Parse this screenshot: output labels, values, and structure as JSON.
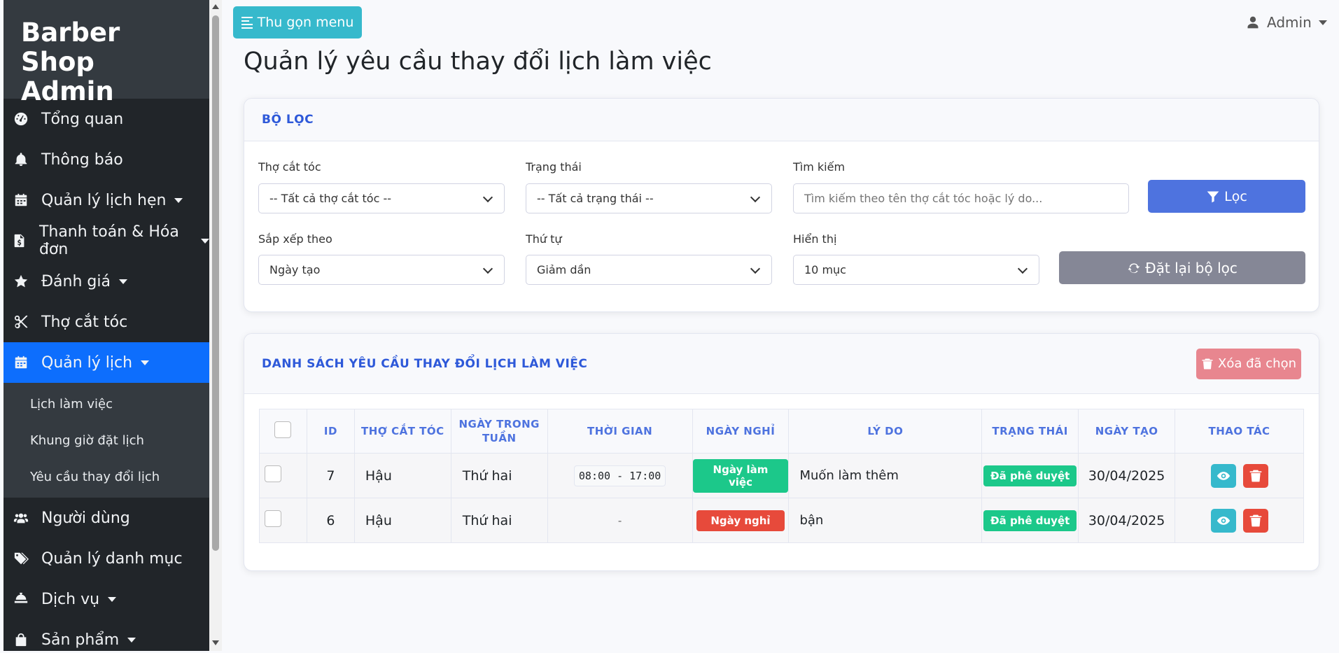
{
  "sidebar": {
    "brand": "Barber Shop Admin",
    "items": [
      {
        "label": "Tổng quan",
        "icon": "dashboard-icon"
      },
      {
        "label": "Thông báo",
        "icon": "bell-icon"
      },
      {
        "label": "Quản lý lịch hẹn",
        "icon": "calendar-icon",
        "dropdown": true
      },
      {
        "label": "Thanh toán & Hóa đơn",
        "icon": "invoice-icon",
        "dropdown": true
      },
      {
        "label": "Đánh giá",
        "icon": "star-icon",
        "dropdown": true
      },
      {
        "label": "Thợ cắt tóc",
        "icon": "scissors-icon"
      },
      {
        "label": "Quản lý lịch",
        "icon": "calendar-icon",
        "dropdown": true,
        "active": true
      },
      {
        "label": "Người dùng",
        "icon": "users-icon"
      },
      {
        "label": "Quản lý danh mục",
        "icon": "tags-icon"
      },
      {
        "label": "Dịch vụ",
        "icon": "service-bell-icon",
        "dropdown": true
      },
      {
        "label": "Sản phẩm",
        "icon": "shopping-bag-icon",
        "dropdown": true
      }
    ],
    "subitems": [
      "Lịch làm việc",
      "Khung giờ đặt lịch",
      "Yêu cầu thay đổi lịch"
    ]
  },
  "topbar": {
    "toggle_label": "Thu gọn menu",
    "user_label": "Admin"
  },
  "page_title": "Quản lý yêu cầu thay đổi lịch làm việc",
  "filter": {
    "title": "BỘ LỌC",
    "barber_label": "Thợ cắt tóc",
    "barber_value": "-- Tất cả thợ cắt tóc --",
    "status_label": "Trạng thái",
    "status_value": "-- Tất cả trạng thái --",
    "search_label": "Tìm kiếm",
    "search_placeholder": "Tìm kiếm theo tên thợ cắt tóc hoặc lý do...",
    "filter_button": "Lọc",
    "sort_label": "Sắp xếp theo",
    "sort_value": "Ngày tạo",
    "order_label": "Thứ tự",
    "order_value": "Giảm dần",
    "display_label": "Hiển thị",
    "display_value": "10 mục",
    "reset_button": "Đặt lại bộ lọc"
  },
  "list": {
    "title": "DANH SÁCH YÊU CẦU THAY ĐỔI LỊCH LÀM VIỆC",
    "delete_selected": "Xóa đã chọn",
    "columns": [
      "ID",
      "THỢ CẮT TÓC",
      "NGÀY TRONG TUẦN",
      "THỜI GIAN",
      "NGÀY NGHỈ",
      "LÝ DO",
      "TRẠNG THÁI",
      "NGÀY TẠO",
      "THAO TÁC"
    ],
    "rows": [
      {
        "id": "7",
        "barber": "Hậu",
        "weekday": "Thứ hai",
        "time": "08:00 - 17:00",
        "day_off": "Ngày làm việc",
        "day_off_color": "#1cc88a",
        "reason": "Muốn làm thêm",
        "status": "Đã phê duyệt",
        "created": "30/04/2025"
      },
      {
        "id": "6",
        "barber": "Hậu",
        "weekday": "Thứ hai",
        "time": "-",
        "day_off": "Ngày nghỉ",
        "day_off_color": "#e74a3b",
        "reason": "bận",
        "status": "Đã phê duyệt",
        "created": "30/04/2025"
      }
    ]
  }
}
